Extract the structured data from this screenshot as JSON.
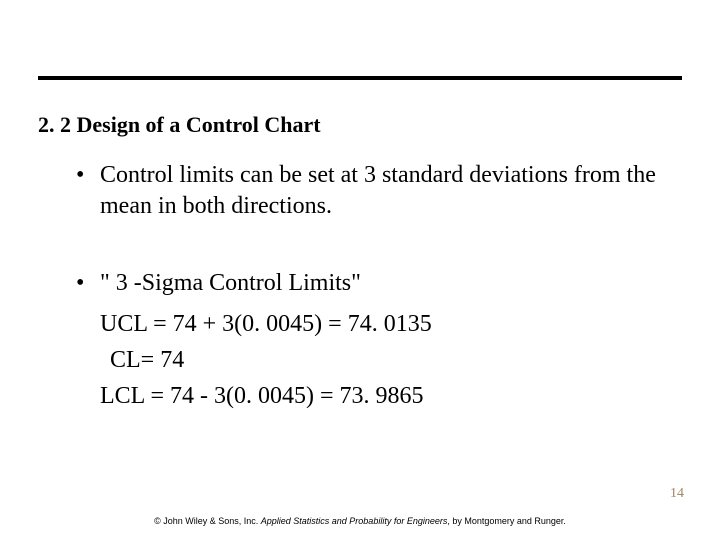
{
  "section": {
    "title": "2. 2 Design of a Control Chart"
  },
  "bullets": {
    "b1": "Control limits can be set at 3 standard deviations from the mean in both directions.",
    "b2": "\" 3 -Sigma Control Limits\""
  },
  "equations": {
    "ucl": "UCL = 74 + 3(0. 0045) = 74. 0135",
    "cl": " CL= 74",
    "lcl": "LCL =  74 - 3(0. 0045) = 73. 9865"
  },
  "page_number": "14",
  "footer": {
    "pub": "© John Wiley & Sons, Inc. ",
    "book": "Applied Statistics and Probability for Engineers",
    "authors": ", by Montgomery and Runger."
  }
}
